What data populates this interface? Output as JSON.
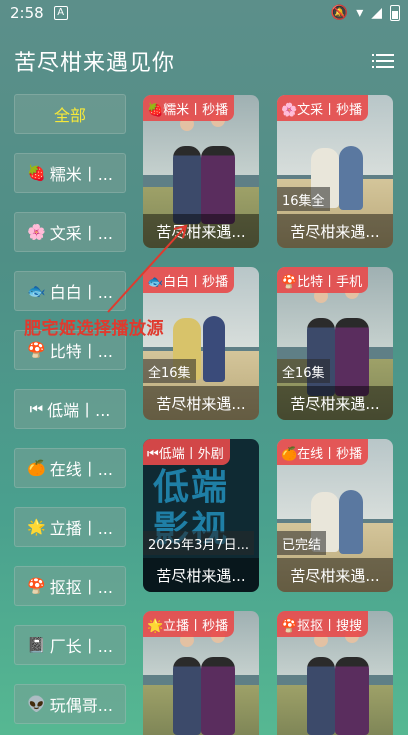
{
  "status_bar": {
    "time": "2:58",
    "notif": "A"
  },
  "header": {
    "title": "苦尽柑来遇见你"
  },
  "sidebar": {
    "items": [
      {
        "label": "全部",
        "emoji": ""
      },
      {
        "label": "糯米丨...",
        "emoji": "🍓"
      },
      {
        "label": "文采丨...",
        "emoji": "🌸"
      },
      {
        "label": "白白丨...",
        "emoji": "🐟"
      },
      {
        "label": "比特丨...",
        "emoji": "🍄"
      },
      {
        "label": "低端丨...",
        "emoji": "⏮"
      },
      {
        "label": "在线丨...",
        "emoji": "🍊"
      },
      {
        "label": "立播丨...",
        "emoji": "🌟"
      },
      {
        "label": "抠抠丨...",
        "emoji": "🍄"
      },
      {
        "label": "厂长丨...",
        "emoji": "📓"
      },
      {
        "label": "玩偶哥...",
        "emoji": "👽"
      }
    ]
  },
  "annotation": {
    "text": "肥宅姬选择播放源"
  },
  "cards": [
    {
      "tag": "🍓糯米丨秒播",
      "badge": "",
      "title": "苦尽柑来遇...",
      "poster": "couple"
    },
    {
      "tag": "🌸文采丨秒播",
      "badge": "16集全",
      "title": "苦尽柑来遇...",
      "poster": "beach"
    },
    {
      "tag": "🐟白白丨秒播",
      "badge": "全16集",
      "title": "苦尽柑来遇...",
      "poster": "beach"
    },
    {
      "tag": "🍄比特丨手机",
      "badge": "全16集",
      "title": "苦尽柑来遇...",
      "poster": "couple"
    },
    {
      "tag": "⏮低端丨外剧",
      "badge": "2025年3月7日...",
      "title": "苦尽柑来遇...",
      "poster": "dark",
      "poster_text": "低端影视"
    },
    {
      "tag": "🍊在线丨秒播",
      "badge": "已完结",
      "title": "苦尽柑来遇...",
      "poster": "beach"
    },
    {
      "tag": "🌟立播丨秒播",
      "badge": "",
      "title": "",
      "poster": "couple"
    },
    {
      "tag": "🍄抠抠丨搜搜",
      "badge": "",
      "title": "",
      "poster": "couple"
    }
  ]
}
